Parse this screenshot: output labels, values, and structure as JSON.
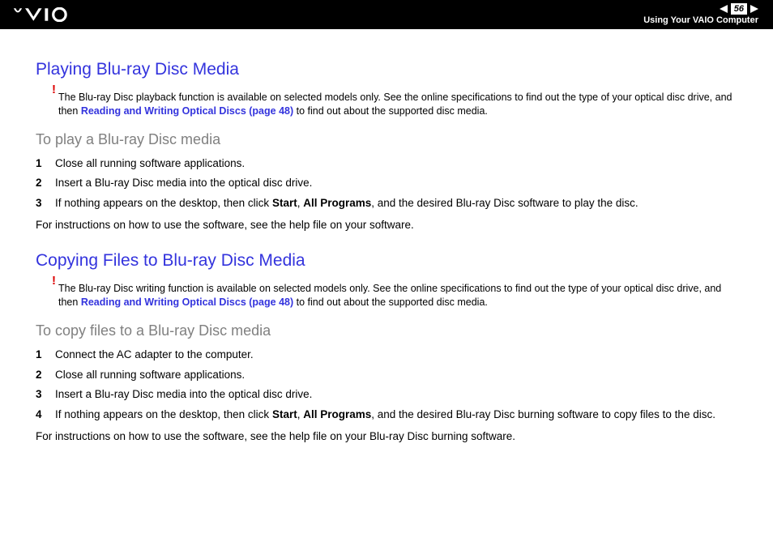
{
  "header": {
    "page_number": "56",
    "breadcrumb": "Using Your VAIO Computer"
  },
  "section1": {
    "title": "Playing Blu-ray Disc Media",
    "note_pre": "The Blu-ray Disc playback function is available on selected models only. See the online specifications to find out the type of your optical disc drive, and then ",
    "note_link": "Reading and Writing Optical Discs (page 48)",
    "note_post": " to find out about the supported disc media.",
    "subhead": "To play a Blu-ray Disc media",
    "steps": [
      {
        "n": "1",
        "text": "Close all running software applications."
      },
      {
        "n": "2",
        "text": "Insert a Blu-ray Disc media into the optical disc drive."
      },
      {
        "n": "3",
        "pre": "If nothing appears on the desktop, then click ",
        "b1": "Start",
        "mid": ", ",
        "b2": "All Programs",
        "post": ", and the desired Blu-ray Disc software to play the disc."
      }
    ],
    "after": "For instructions on how to use the software, see the help file on your software."
  },
  "section2": {
    "title": "Copying Files to Blu-ray Disc Media",
    "note_pre": "The Blu-ray Disc writing function is available on selected models only. See the online specifications to find out the type of your optical disc drive, and then ",
    "note_link": "Reading and Writing Optical Discs (page 48)",
    "note_post": " to find out about the supported disc media.",
    "subhead": "To copy files to a Blu-ray Disc media",
    "steps": [
      {
        "n": "1",
        "text": "Connect the AC adapter to the computer."
      },
      {
        "n": "2",
        "text": "Close all running software applications."
      },
      {
        "n": "3",
        "text": "Insert a Blu-ray Disc media into the optical disc drive."
      },
      {
        "n": "4",
        "pre": "If nothing appears on the desktop, then click ",
        "b1": "Start",
        "mid": ", ",
        "b2": "All Programs",
        "post": ", and the desired Blu-ray Disc burning software to copy files to the disc."
      }
    ],
    "after": "For instructions on how to use the software, see the help file on your Blu-ray Disc burning software."
  }
}
